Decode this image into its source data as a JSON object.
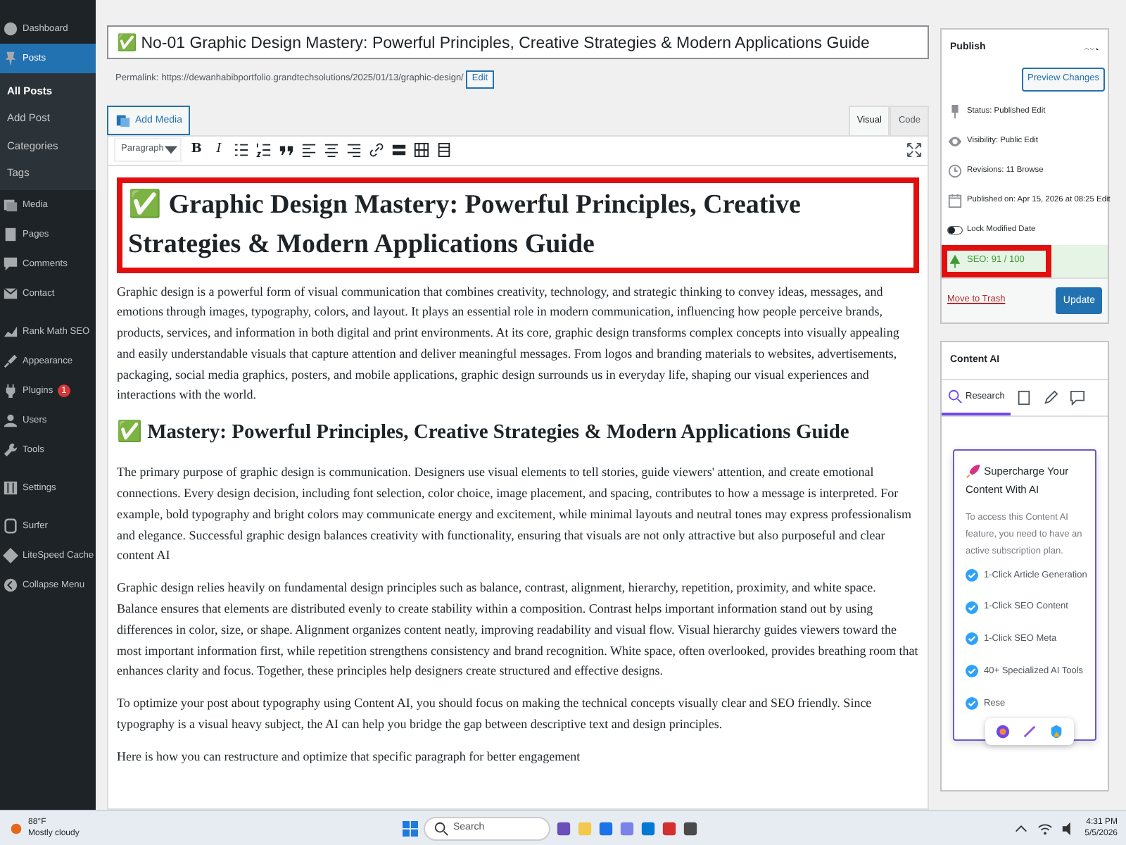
{
  "sidebar": {
    "items": [
      {
        "label": "Dashboard",
        "selected": false
      },
      {
        "label": "Posts",
        "selected": true,
        "children": [
          {
            "label": "All Posts",
            "selected": true
          },
          {
            "label": "Add Post",
            "selected": false
          },
          {
            "label": "Categories",
            "selected": false
          },
          {
            "label": "Tags",
            "selected": false
          }
        ]
      },
      {
        "label": "Media",
        "selected": false
      },
      {
        "label": "Pages",
        "selected": false
      },
      {
        "label": "Comments",
        "selected": false
      },
      {
        "label": "Contact",
        "selected": false
      },
      {
        "label": "Rank Math SEO",
        "selected": false
      },
      {
        "label": "Appearance",
        "selected": false
      },
      {
        "label": "Plugins",
        "selected": false,
        "badge": "1"
      },
      {
        "label": "Users",
        "selected": false
      },
      {
        "label": "Tools",
        "selected": false
      },
      {
        "label": "Settings",
        "selected": false
      },
      {
        "label": "Surfer",
        "selected": false
      },
      {
        "label": "LiteSpeed Cache",
        "selected": false
      },
      {
        "label": "Collapse Menu",
        "selected": false
      }
    ]
  },
  "post_title": "✅ No-01 Graphic Design Mastery: Powerful Principles, Creative Strategies & Modern Applications Guide",
  "permalink": {
    "label": "Permalink:",
    "url": "https://dewanhabibportfolio.grandtechsolutions/2025/01/13/graphic-design/",
    "button": "Edit"
  },
  "add_media": "Add Media",
  "editor_tabs": [
    {
      "label": "Visual",
      "selected": true
    },
    {
      "label": "Code",
      "selected": false
    }
  ],
  "toolbar": {
    "format": "Paragraph",
    "buttons": [
      {
        "kind": "text",
        "label": "B"
      },
      {
        "kind": "text",
        "label": "I"
      },
      {
        "kind": "bullets"
      },
      {
        "kind": "numbers"
      },
      {
        "kind": "quote"
      },
      {
        "kind": "align-left"
      },
      {
        "kind": "align-center"
      },
      {
        "kind": "align-right"
      },
      {
        "kind": "link"
      },
      {
        "kind": "more"
      },
      {
        "kind": "table"
      },
      {
        "kind": "toolbar"
      }
    ]
  },
  "content": [
    {
      "kind": "h1",
      "text": "✅ Graphic Design Mastery: Powerful Principles, Creative Strategies & Modern Applications Guide",
      "highlighted": true
    },
    {
      "kind": "p",
      "text": "Graphic design is a powerful form of visual communication that combines creativity, technology, and strategic thinking to convey ideas, messages, and emotions through images, typography, colors, and layout. It plays an essential role in modern communication, influencing how people perceive brands, products, services, and information in both digital and print environments. At its core, graphic design transforms complex concepts into visually appealing and easily understandable visuals that capture attention and deliver meaningful messages. From logos and branding materials to websites, advertisements, packaging, social media graphics, posters, and mobile applications, graphic design surrounds us in everyday life, shaping our visual experiences and interactions with the world."
    },
    {
      "kind": "h2",
      "text": "✅ Mastery: Powerful Principles, Creative Strategies & Modern Applications Guide",
      "highlighted": false
    },
    {
      "kind": "p",
      "text": "The primary purpose of graphic design is communication. Designers use visual elements to tell stories, guide viewers' attention, and create emotional connections. Every design decision, including font selection, color choice, image placement, and spacing, contributes to how a message is interpreted. For example, bold typography and bright colors may communicate energy and excitement, while minimal layouts and neutral tones may express professionalism and elegance. Successful graphic design balances creativity with functionality, ensuring that visuals are not only attractive but also purposeful and clear content AI"
    },
    {
      "kind": "p",
      "text": "Graphic design relies heavily on fundamental design principles such as balance, contrast, alignment, hierarchy, repetition, proximity, and white space. Balance ensures that elements are distributed evenly to create stability within a composition. Contrast helps important information stand out by using differences in color, size, or shape. Alignment organizes content neatly, improving readability and visual flow. Visual hierarchy guides viewers toward the most important information first, while repetition strengthens consistency and brand recognition. White space, often overlooked, provides breathing room that enhances clarity and focus. Together, these principles help designers create structured and effective designs."
    },
    {
      "kind": "p",
      "text": "To optimize your post about typography using Content AI, you should focus on making the technical concepts visually clear and SEO friendly. Since typography is a visual heavy subject, the AI can help you bridge the gap between descriptive text and design principles."
    },
    {
      "kind": "p",
      "text": "Here is how you can restructure and optimize that specific paragraph for better engagement"
    }
  ],
  "publish": {
    "title": "Publish",
    "preview_button": "Preview Changes",
    "rows": [
      {
        "kind": "status",
        "text": "Status: Published",
        "link": "Edit"
      },
      {
        "kind": "visibility",
        "text": "Visibility: Public",
        "link": "Edit"
      },
      {
        "kind": "revisions",
        "text": "Revisions: 11",
        "link": "Browse"
      },
      {
        "kind": "date",
        "text": "Published on: Apr 15, 2026 at 08:25",
        "link": "Edit"
      }
    ],
    "lock_modified": {
      "label": "Lock Modified Date",
      "on": false
    },
    "seo_score": {
      "text": "SEO: 91 / 100",
      "highlighted": true
    },
    "trash": "Move to Trash",
    "update_button": "Update"
  },
  "content_ai": {
    "title": "Content AI",
    "tabs": [
      {
        "label": "Research",
        "selected": true
      },
      {
        "selected": false
      },
      {
        "selected": false
      },
      {
        "selected": false
      }
    ]
  },
  "upsell_popup": {
    "title": "Supercharge Your Content With AI",
    "text": "To access this Content AI feature, you need to have an active subscription plan.",
    "features": [
      {
        "label": "1-Click Article Generation",
        "checked": true
      },
      {
        "label": "1-Click SEO Content",
        "checked": true
      },
      {
        "label": "1-Click SEO Meta",
        "checked": true
      },
      {
        "label": "40+ Specialized AI Tools",
        "checked": true
      },
      {
        "label": "Rese",
        "checked": true
      }
    ]
  },
  "taskbar": {
    "weather_temp": "88°F",
    "weather_text": "Mostly cloudy",
    "search_placeholder": "Search",
    "time": "4:31 PM",
    "date": "5/5/2026"
  }
}
